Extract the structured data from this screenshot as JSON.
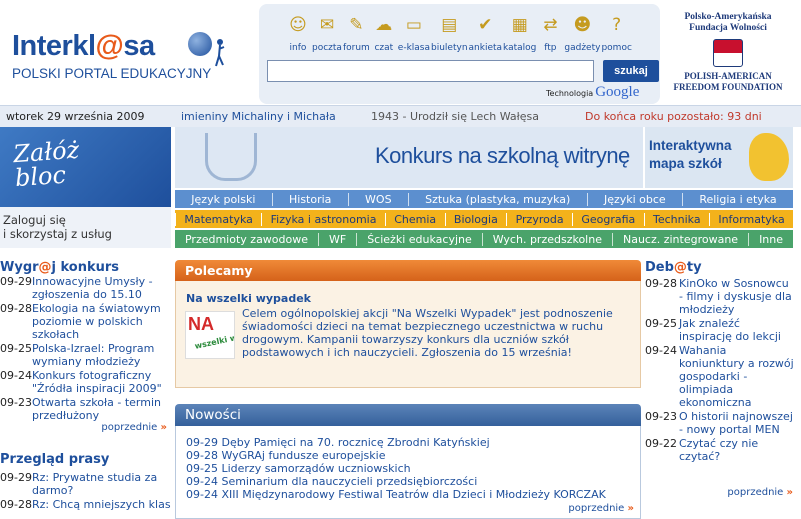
{
  "header": {
    "logo_prefix": "Interkl",
    "logo_at": "@",
    "logo_suffix": "sa",
    "tagline": "POLSKI PORTAL EDUKACYJNY",
    "toolbar": [
      {
        "label": "info",
        "icon": "info-person-icon",
        "glyph": "☺"
      },
      {
        "label": "poczta",
        "icon": "mail-icon",
        "glyph": "✉"
      },
      {
        "label": "forum",
        "icon": "forum-icon",
        "glyph": "✎"
      },
      {
        "label": "czat",
        "icon": "chat-icon",
        "glyph": "☁"
      },
      {
        "label": "e-klasa",
        "icon": "blackboard-icon",
        "glyph": "▭"
      },
      {
        "label": "biuletyn",
        "icon": "bulletin-icon",
        "glyph": "▤"
      },
      {
        "label": "ankieta",
        "icon": "survey-icon",
        "glyph": "✔"
      },
      {
        "label": "katalog",
        "icon": "catalog-icon",
        "glyph": "▦"
      },
      {
        "label": "ftp",
        "icon": "ftp-icon",
        "glyph": "⇄"
      },
      {
        "label": "gadżety",
        "icon": "gadgets-icon",
        "glyph": "☻"
      },
      {
        "label": "pomoc",
        "icon": "help-icon",
        "glyph": "?"
      }
    ],
    "search_button": "szukaj",
    "search_value": "",
    "powered_label": "Technologia",
    "powered_brand": "Google",
    "sponsor_pl_line1": "Polsko-Amerykańska",
    "sponsor_pl_line2": "Fundacja Wolności",
    "sponsor_en_line1": "POLISH-AMERICAN",
    "sponsor_en_line2": "FREEDOM FOUNDATION"
  },
  "datebar": {
    "date": "wtorek 29 września 2009",
    "nameday": "imieniny Michaliny i Michała",
    "history": "1943 - Urodził się Lech Wałęsa",
    "countdown": "Do końca roku pozostało: 93 dni"
  },
  "left": {
    "blog_banner": "Załóż\nbloc",
    "login_text": "Zaloguj się\ni skorzystaj z usług",
    "contest_title_pre": "Wygr",
    "contest_title_at": "@",
    "contest_title_post": "j konkurs",
    "contests": [
      {
        "date": "09-29",
        "text": "Innowacyjne Umysły - zgłoszenia do 15.10"
      },
      {
        "date": "09-28",
        "text": "Ekologia na światowym poziomie w polskich szkołach"
      },
      {
        "date": "09-25",
        "text": "Polska-Izrael: Program wymiany młodzieży"
      },
      {
        "date": "09-24",
        "text": "Konkurs fotograficzny \"Źródła inspiracji 2009\""
      },
      {
        "date": "09-23",
        "text": "Otwarta szkoła - termin przedłużony"
      }
    ],
    "contests_more": "poprzednie",
    "press_title": "Przegląd prasy",
    "press": [
      {
        "date": "09-29",
        "text": "Rz: Prywatne studia za darmo?"
      },
      {
        "date": "09-28",
        "text": "Rz: Chcą mniejszych klas"
      }
    ]
  },
  "banners": {
    "promo": "Konkurs na szkolną witrynę",
    "map": "Interaktywna\nmapa szkół"
  },
  "nav": {
    "row1": [
      "Język polski",
      "Historia",
      "WOS",
      "Sztuka (plastyka, muzyka)",
      "Języki obce",
      "Religia i etyka"
    ],
    "row2": [
      "Matematyka",
      "Fizyka i astronomia",
      "Chemia",
      "Biologia",
      "Przyroda",
      "Geografia",
      "Technika",
      "Informatyka"
    ],
    "row3": [
      "Przedmioty zawodowe",
      "WF",
      "Ścieżki edukacyjne",
      "Wych. przedszkolne",
      "Naucz. zintegrowane",
      "Inne"
    ]
  },
  "polecamy": {
    "header": "Polecamy",
    "title": "Na wszelki wypadek",
    "image_big": "NA",
    "image_small": "wszelki wypadek",
    "text": "Celem ogólnopolskiej akcji \"Na Wszelki Wypadek\" jest podnoszenie świadomości dzieci na temat bezpiecznego uczestnictwa w ruchu drogowym. Kampanii towarzyszy konkurs dla uczniów szkół podstawowych i ich nauczycieli. Zgłoszenia do 15 września!"
  },
  "nowosci": {
    "header": "Nowości",
    "items": [
      {
        "date": "09-29",
        "text": "Dęby Pamięci na 70. rocznicę Zbrodni Katyńskiej"
      },
      {
        "date": "09-28",
        "text": "WyGRAj fundusze europejskie"
      },
      {
        "date": "09-25",
        "text": "Liderzy samorządów uczniowskich"
      },
      {
        "date": "09-24",
        "text": "Seminarium dla nauczycieli przedsiębiorczości"
      },
      {
        "date": "09-24",
        "text": "XIII Międzynarodowy Festiwal Teatrów dla Dzieci i Młodzieży KORCZAK"
      }
    ],
    "more": "poprzednie"
  },
  "debaty": {
    "title_pre": "Deb",
    "title_at": "@",
    "title_post": "ty",
    "items": [
      {
        "date": "09-28",
        "text": "KinOko w Sosnowcu - filmy i dyskusje dla młodzieży"
      },
      {
        "date": "09-25",
        "text": "Jak znaleźć inspirację do lekcji"
      },
      {
        "date": "09-24",
        "text": "Wahania koniunktury a rozwój gospodarki - olimpiada ekonomiczna"
      },
      {
        "date": "09-23",
        "text": "O historii najnowszej - nowy portal MEN"
      },
      {
        "date": "09-22",
        "text": "Czytać czy nie czytać?"
      }
    ],
    "more": "poprzednie"
  },
  "colors": {
    "brand_blue": "#1e4f9c",
    "accent_orange": "#e85a1a",
    "nav_blue": "#5c8fcf",
    "nav_yellow": "#f3b21b",
    "nav_green": "#4aa36a"
  }
}
